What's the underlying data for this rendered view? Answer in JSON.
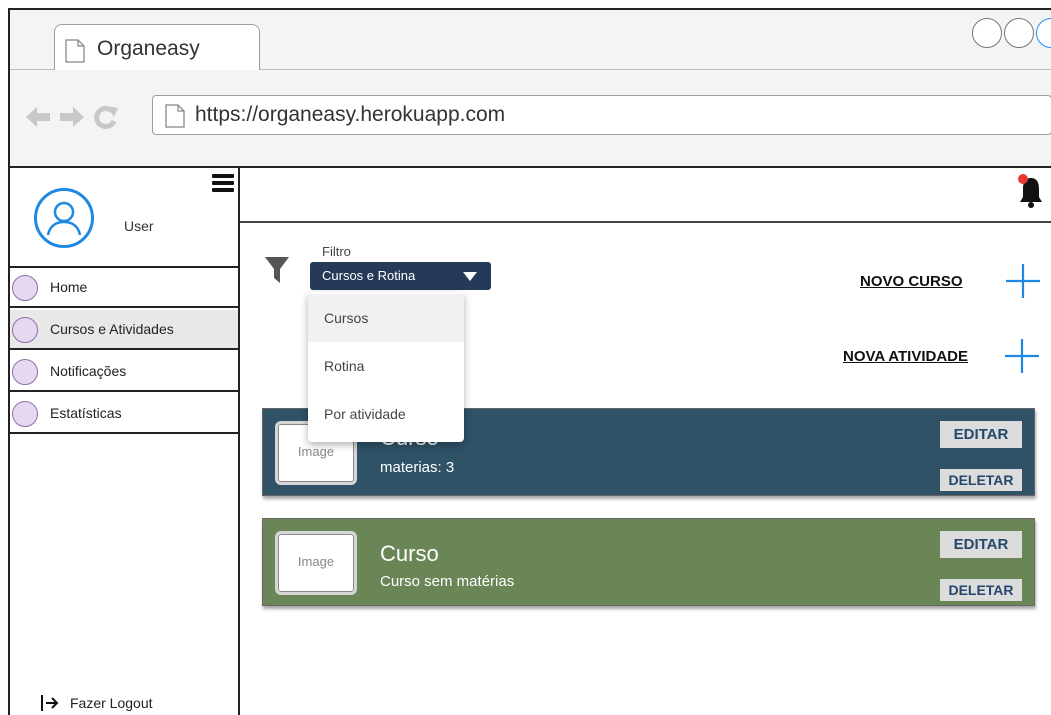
{
  "browser": {
    "tab_title": "Organeasy",
    "url": "https://organeasy.herokuapp.com"
  },
  "sidebar": {
    "user_label": "User",
    "items": [
      {
        "label": "Home"
      },
      {
        "label": "Cursos e Atividades"
      },
      {
        "label": "Notificações"
      },
      {
        "label": "Estatísticas"
      }
    ],
    "logout_label": "Fazer Logout"
  },
  "filter": {
    "label": "Filtro",
    "selected": "Cursos e Rotina",
    "options": [
      "Cursos",
      "Rotina",
      "Por atividade"
    ]
  },
  "actions": {
    "new_course": "NOVO CURSO",
    "new_activity": "NOVA ATIVIDADE"
  },
  "courses": [
    {
      "image_label": "Image",
      "title": "Curso",
      "subtitle": "materias: 3",
      "edit": "EDITAR",
      "delete": "DELETAR",
      "color": "#2f5266"
    },
    {
      "image_label": "Image",
      "title": "Curso",
      "subtitle": "Curso sem matérias",
      "edit": "EDITAR",
      "delete": "DELETAR",
      "color": "#6a8556"
    }
  ],
  "colors": {
    "accent": "#1e88e5",
    "notification_dot": "#e53935",
    "select_bg": "#243a58"
  }
}
